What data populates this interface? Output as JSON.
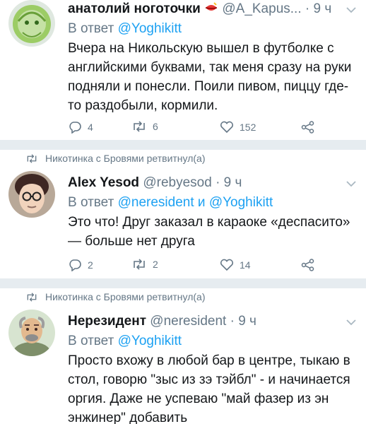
{
  "tweets": [
    {
      "name": "анатолий ноготочки",
      "handle": "@A_Kapus...",
      "time": "9 ч",
      "reply_prefix": "В ответ",
      "reply_links": [
        "@Yoghikitt"
      ],
      "text": "Вчера на Никольскую вышел в футболке с английскими буквами, так меня сразу на руки подняли и понесли. Поили пивом, пиццу где-то раздобыли, кормили.",
      "replies": "4",
      "retweets": "6",
      "likes": "152"
    },
    {
      "retweeted_by": "Никотинка с Бровями ретвитнул(а)",
      "name": "Alex Yesod",
      "handle": "@rebyesod",
      "time": "9 ч",
      "reply_prefix": "В ответ",
      "reply_links": [
        "@neresident",
        "@Yoghikitt"
      ],
      "reply_joiner": "и",
      "text": "Это что! Друг заказал в караоке «деспасито» — больше нет друга",
      "replies": "2",
      "retweets": "2",
      "likes": "14"
    },
    {
      "retweeted_by": "Никотинка с Бровями ретвитнул(а)",
      "name": "Нерезидент",
      "handle": "@neresident",
      "time": "9 ч",
      "reply_prefix": "В ответ",
      "reply_links": [
        "@Yoghikitt"
      ],
      "text": "Просто вхожу в любой бар в центре, тыкаю в стол, говорю \"зыс из зэ тэйбл\" - и начинается оргия. Даже не успеваю \"май фазер из эн энжинер\" добавить"
    }
  ],
  "separator_symbol": "·",
  "colors": {
    "link": "#1da1f2",
    "secondary": "#657786",
    "separator": "#e6ecf0"
  }
}
